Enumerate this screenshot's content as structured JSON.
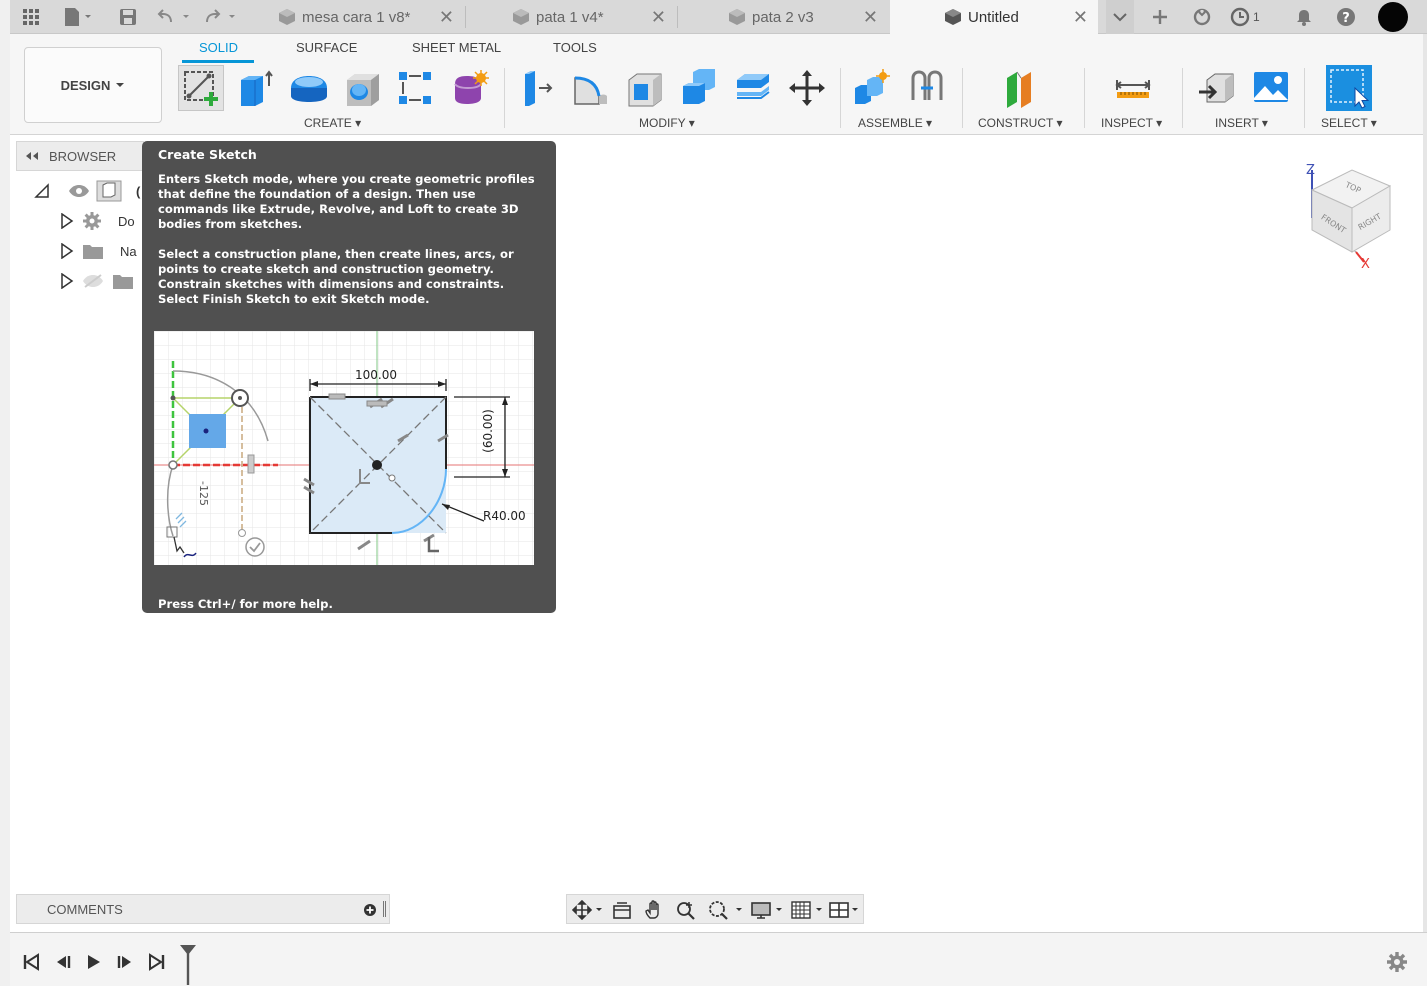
{
  "tabs": [
    {
      "label": "mesa cara 1 v8*",
      "active": false
    },
    {
      "label": "pata 1 v4*",
      "active": false
    },
    {
      "label": "pata 2 v3",
      "active": false
    },
    {
      "label": "Untitled",
      "active": true
    }
  ],
  "jobs_count": "1",
  "workspace": {
    "label": "DESIGN"
  },
  "ribbon_tabs": [
    "SOLID",
    "SURFACE",
    "SHEET METAL",
    "TOOLS"
  ],
  "groups": {
    "create": "CREATE",
    "modify": "MODIFY",
    "assemble": "ASSEMBLE",
    "construct": "CONSTRUCT",
    "inspect": "INSPECT",
    "insert": "INSERT",
    "select": "SELECT"
  },
  "browser": {
    "label": "BROWSER",
    "root_label": "(",
    "items": [
      {
        "label": "Do"
      },
      {
        "label": "Na"
      },
      {
        "label": ""
      }
    ]
  },
  "tooltip": {
    "title": "Create Sketch",
    "paragraph1": "Enters Sketch mode, where you create geometric profiles that define the foundation of a design. Then use commands like Extrude, Revolve, and Loft to create 3D bodies from sketches.",
    "paragraph2": "Select a construction plane, then create lines, arcs, or points to create sketch and construction geometry. Constrain sketches with dimensions and constraints. Select Finish Sketch to exit Sketch mode.",
    "footer": "Press Ctrl+/ for more help.",
    "illustration": {
      "dim_width": "100.00",
      "dim_height": "(60.00)",
      "dim_radius": "R40.00",
      "dim_small": "-125"
    }
  },
  "viewcube": {
    "top": "TOP",
    "front": "FRONT",
    "right": "RIGHT",
    "axis_z": "Z",
    "axis_x": "X"
  },
  "comments": {
    "label": "COMMENTS"
  },
  "colors": {
    "accent": "#0696d7",
    "tooltip_bg": "#505050",
    "select_blue": "#1b8fe0"
  }
}
